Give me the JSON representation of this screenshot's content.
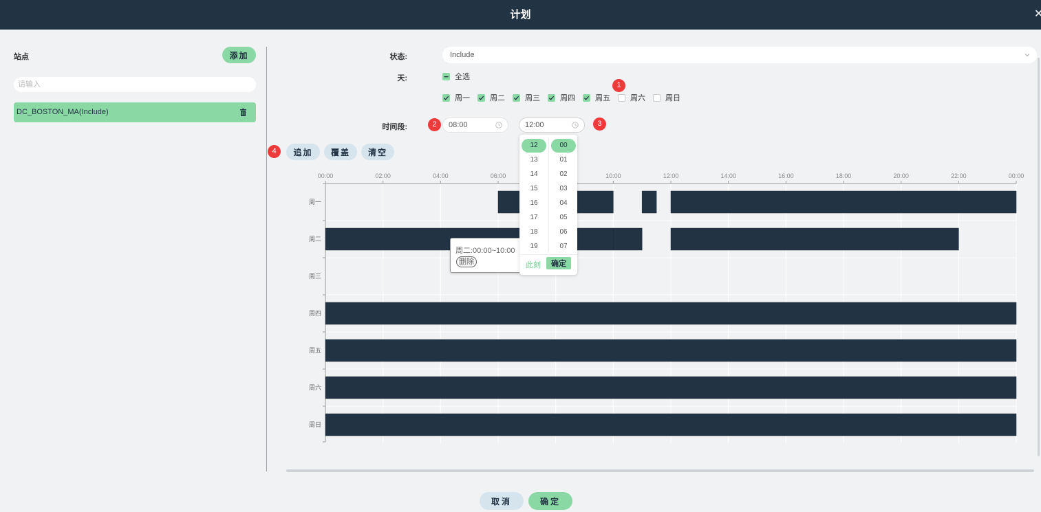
{
  "dialog": {
    "title": "计划"
  },
  "stations": {
    "title": "站点",
    "add_label": "添加",
    "search_placeholder": "请输入",
    "items": [
      {
        "label": "DC_BOSTON_MA(Include)"
      }
    ]
  },
  "form": {
    "status_label": "状态:",
    "status_value": "Include",
    "days_label": "天:",
    "select_all_label": "全选",
    "days": [
      {
        "label": "周一",
        "checked": true
      },
      {
        "label": "周二",
        "checked": true
      },
      {
        "label": "周三",
        "checked": true
      },
      {
        "label": "周四",
        "checked": true
      },
      {
        "label": "周五",
        "checked": true
      },
      {
        "label": "周六",
        "checked": false
      },
      {
        "label": "周日",
        "checked": false
      }
    ],
    "period_label": "时间段:",
    "start_time": "08:00",
    "end_time": "12:00"
  },
  "badges": [
    "1",
    "2",
    "3",
    "4"
  ],
  "actions": {
    "append": "追加",
    "overwrite": "覆盖",
    "clear": "清空"
  },
  "time_picker": {
    "hours": [
      "12",
      "13",
      "14",
      "15",
      "16",
      "17",
      "18",
      "19"
    ],
    "minutes": [
      "00",
      "01",
      "02",
      "03",
      "04",
      "05",
      "06",
      "07"
    ],
    "selected_hour": "12",
    "selected_minute": "00",
    "now_label": "此刻",
    "ok_label": "确定"
  },
  "tooltip": {
    "text": "周二:00:00~10:00",
    "delete_label": "删除"
  },
  "chart_data": {
    "type": "gantt",
    "x_ticks": [
      "00:00",
      "02:00",
      "04:00",
      "06:00",
      "08:00",
      "10:00",
      "12:00",
      "14:00",
      "16:00",
      "18:00",
      "20:00",
      "22:00",
      "00:00"
    ],
    "rows": [
      "周一",
      "周二",
      "周三",
      "周四",
      "周五",
      "周六",
      "周日"
    ],
    "x_range_hours": [
      0,
      24
    ],
    "bar_color": "#223344",
    "segments": [
      {
        "row": 0,
        "start": 6,
        "end": 10
      },
      {
        "row": 0,
        "start": 11,
        "end": 11.5
      },
      {
        "row": 0,
        "start": 12,
        "end": 24
      },
      {
        "row": 1,
        "start": 0,
        "end": 10
      },
      {
        "row": 1,
        "start": 10,
        "end": 11
      },
      {
        "row": 1,
        "start": 12,
        "end": 22
      },
      {
        "row": 3,
        "start": 0,
        "end": 24
      },
      {
        "row": 4,
        "start": 0,
        "end": 24
      },
      {
        "row": 5,
        "start": 0,
        "end": 24
      },
      {
        "row": 6,
        "start": 0,
        "end": 24
      }
    ],
    "grid": true
  },
  "footer": {
    "cancel": "取消",
    "ok": "确定"
  },
  "colors": {
    "header": "#223344",
    "accent": "#8ad8a4",
    "light_button": "#d6e4ee",
    "badge": "#ee3a3a"
  }
}
